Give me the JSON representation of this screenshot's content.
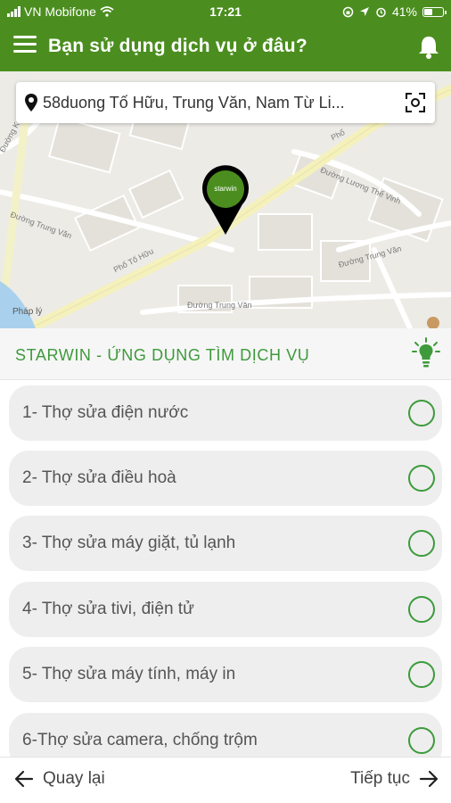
{
  "status_bar": {
    "carrier": "VN Mobifone",
    "time": "17:21",
    "battery": "41%",
    "battery_level": 0.41
  },
  "header": {
    "title": "Bạn sử dụng dịch vụ ở đâu?",
    "background": "#4b8e1f"
  },
  "search": {
    "address": "58duong Tố Hữu, Trung Văn, Nam Từ Li..."
  },
  "map": {
    "streets": [
      "Phố Tố Hữu",
      "Đường Trung Văn",
      "Đường Trung Văn",
      "Đường Trung Văn",
      "Đường Lương Thế Vinh",
      "Phố",
      "Đường K"
    ],
    "marker_label": "starwin",
    "attribution": "Pháp lý"
  },
  "section": {
    "title": "STARWIN - ỨNG DỤNG TÌM DỊCH VỤ",
    "accent": "#3e9a3b"
  },
  "services": [
    {
      "label": "1- Thợ sửa điện nước",
      "selected": false
    },
    {
      "label": "2- Thợ sửa điều hoà",
      "selected": false
    },
    {
      "label": "3- Thợ sửa máy giặt, tủ lạnh",
      "selected": false
    },
    {
      "label": "4- Thợ sửa tivi, điện tử",
      "selected": false
    },
    {
      "label": "5- Thợ sửa máy tính, máy in",
      "selected": false
    },
    {
      "label": "6-Thợ sửa camera, chống trộm",
      "selected": false
    }
  ],
  "footer": {
    "back_label": "Quay lại",
    "next_label": "Tiếp tục"
  },
  "icons": [
    "menu-icon",
    "bell-icon",
    "location-pin-icon",
    "scan-icon",
    "map-marker-icon",
    "lightbulb-icon",
    "arrow-left-icon",
    "arrow-right-icon"
  ]
}
